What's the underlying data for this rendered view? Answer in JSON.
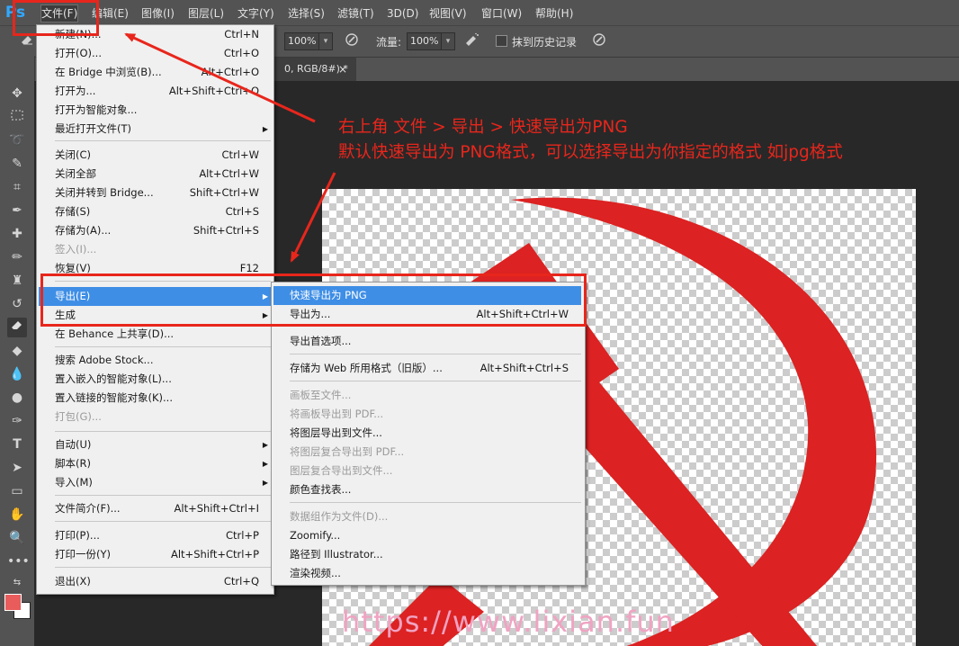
{
  "app": {
    "logo": "Ps"
  },
  "menubar": {
    "items": [
      "文件(F)",
      "编辑(E)",
      "图像(I)",
      "图层(L)",
      "文字(Y)",
      "选择(S)",
      "滤镜(T)",
      "3D(D)",
      "视图(V)",
      "窗口(W)",
      "帮助(H)"
    ]
  },
  "options": {
    "opacity_value": "100%",
    "flow_label": "流量:",
    "flow_value": "100%",
    "history_label": "抹到历史记录"
  },
  "document_tab": {
    "title": "0, RGB/8#) *",
    "close": "×"
  },
  "file_menu": {
    "items": [
      {
        "label": "新建(N)...",
        "shortcut": "Ctrl+N"
      },
      {
        "label": "打开(O)...",
        "shortcut": "Ctrl+O"
      },
      {
        "label": "在 Bridge 中浏览(B)...",
        "shortcut": "Alt+Ctrl+O"
      },
      {
        "label": "打开为...",
        "shortcut": "Alt+Shift+Ctrl+O"
      },
      {
        "label": "打开为智能对象...",
        "shortcut": ""
      },
      {
        "label": "最近打开文件(T)",
        "shortcut": ""
      },
      {
        "label": "关闭(C)",
        "shortcut": "Ctrl+W"
      },
      {
        "label": "关闭全部",
        "shortcut": "Alt+Ctrl+W"
      },
      {
        "label": "关闭并转到 Bridge...",
        "shortcut": "Shift+Ctrl+W"
      },
      {
        "label": "存储(S)",
        "shortcut": "Ctrl+S"
      },
      {
        "label": "存储为(A)...",
        "shortcut": "Shift+Ctrl+S"
      },
      {
        "label": "签入(I)...",
        "shortcut": ""
      },
      {
        "label": "恢复(V)",
        "shortcut": "F12"
      },
      {
        "label": "导出(E)",
        "shortcut": ""
      },
      {
        "label": "生成",
        "shortcut": ""
      },
      {
        "label": "在 Behance 上共享(D)...",
        "shortcut": ""
      },
      {
        "label": "搜索 Adobe Stock...",
        "shortcut": ""
      },
      {
        "label": "置入嵌入的智能对象(L)...",
        "shortcut": ""
      },
      {
        "label": "置入链接的智能对象(K)...",
        "shortcut": ""
      },
      {
        "label": "打包(G)...",
        "shortcut": ""
      },
      {
        "label": "自动(U)",
        "shortcut": ""
      },
      {
        "label": "脚本(R)",
        "shortcut": ""
      },
      {
        "label": "导入(M)",
        "shortcut": ""
      },
      {
        "label": "文件简介(F)...",
        "shortcut": "Alt+Shift+Ctrl+I"
      },
      {
        "label": "打印(P)...",
        "shortcut": "Ctrl+P"
      },
      {
        "label": "打印一份(Y)",
        "shortcut": "Alt+Shift+Ctrl+P"
      },
      {
        "label": "退出(X)",
        "shortcut": "Ctrl+Q"
      }
    ]
  },
  "export_menu": {
    "items": [
      {
        "label": "快速导出为 PNG",
        "shortcut": ""
      },
      {
        "label": "导出为...",
        "shortcut": "Alt+Shift+Ctrl+W"
      },
      {
        "label": "导出首选项...",
        "shortcut": ""
      },
      {
        "label": "存储为 Web 所用格式（旧版）...",
        "shortcut": "Alt+Shift+Ctrl+S"
      },
      {
        "label": "画板至文件...",
        "shortcut": ""
      },
      {
        "label": "将画板导出到 PDF...",
        "shortcut": ""
      },
      {
        "label": "将图层导出到文件...",
        "shortcut": ""
      },
      {
        "label": "将图层复合导出到 PDF...",
        "shortcut": ""
      },
      {
        "label": "图层复合导出到文件...",
        "shortcut": ""
      },
      {
        "label": "颜色查找表...",
        "shortcut": ""
      },
      {
        "label": "数据组作为文件(D)...",
        "shortcut": ""
      },
      {
        "label": "Zoomify...",
        "shortcut": ""
      },
      {
        "label": "路径到 Illustrator...",
        "shortcut": ""
      },
      {
        "label": "渲染视频...",
        "shortcut": ""
      }
    ]
  },
  "annotation": {
    "line1": "右上角 文件 > 导出 > 快速导出为PNG",
    "line2": "默认快速导出为 PNG格式，可以选择导出为你指定的格式 如jpg格式"
  },
  "watermark": "https://www.lixian.fun",
  "colors": {
    "annotation_red": "#e8261c",
    "highlight_blue": "#3e8ee6",
    "foreground_swatch": "#e85c5c",
    "background_swatch": "#ffffff",
    "artwork_red": "#dc2222"
  },
  "icons": {
    "eraser_tool": "eraser-icon",
    "airbrush": "airbrush-icon",
    "pressure": "pressure-icon"
  }
}
